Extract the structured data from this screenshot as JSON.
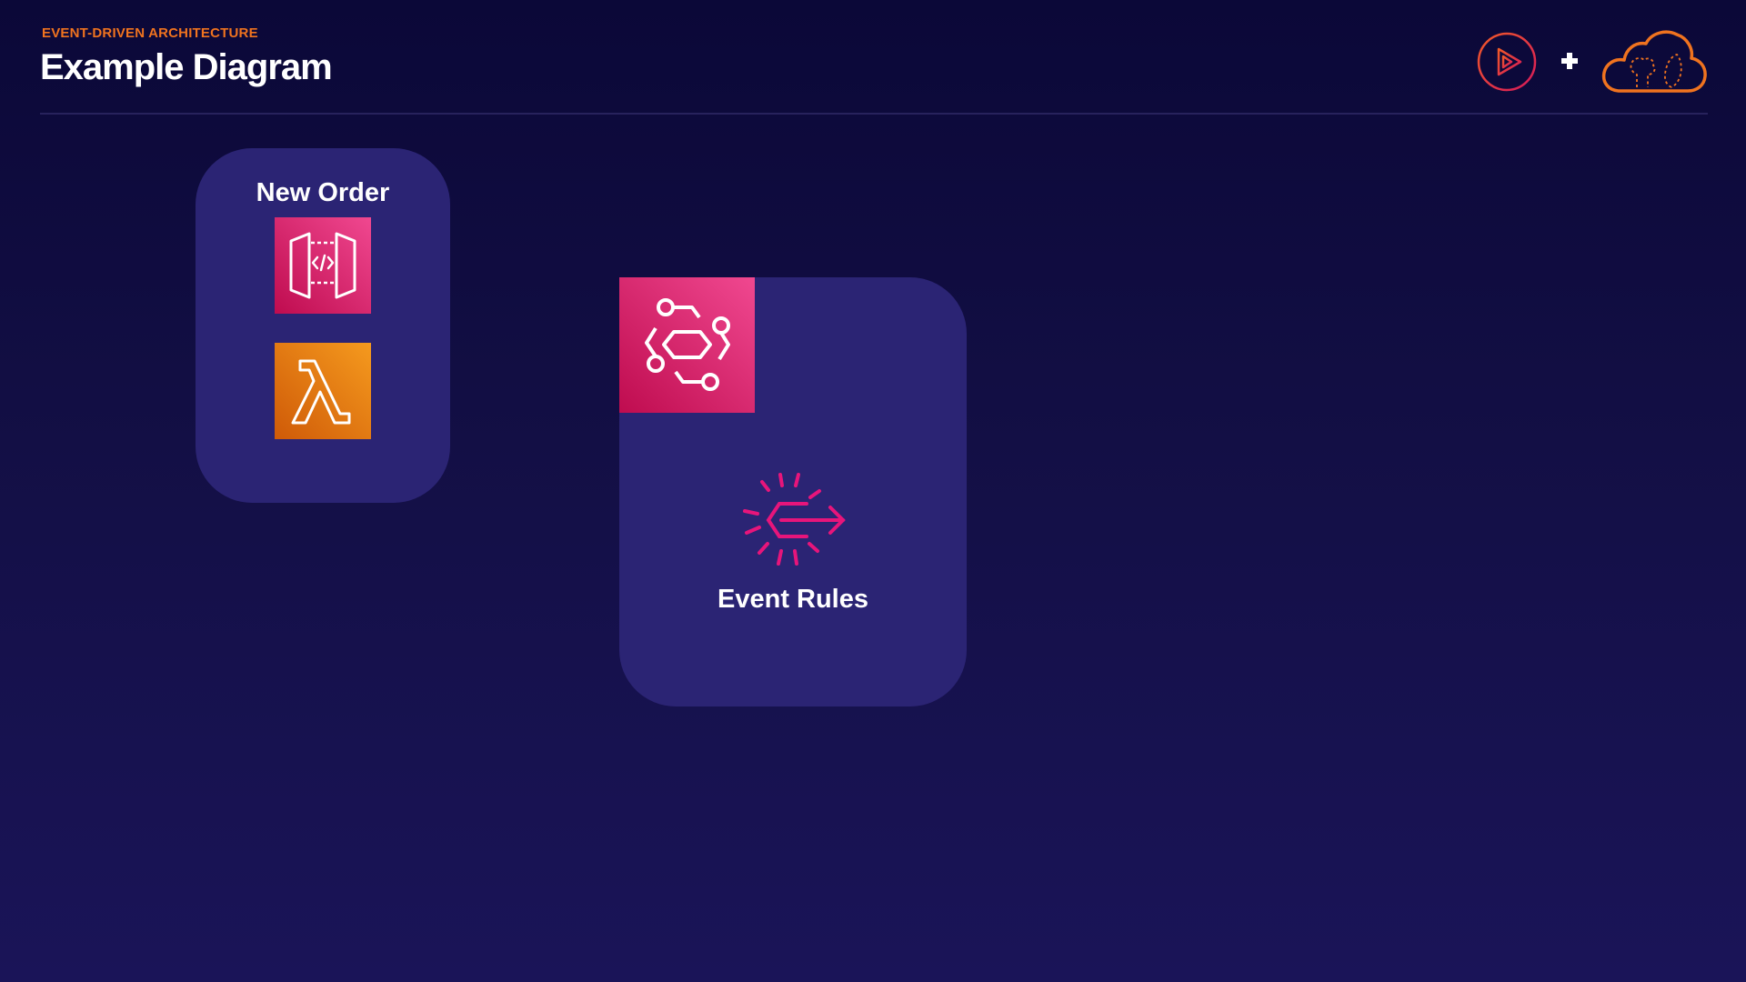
{
  "header": {
    "eyebrow": "EVENT-DRIVEN ARCHITECTURE",
    "title": "Example Diagram"
  },
  "brand": {
    "play_icon": "play-circle-icon",
    "plus_icon": "plus-icon",
    "cloud_icon": "cloud-brain-icon",
    "play_color": "#e0244f",
    "cloud_color": "#f0731f"
  },
  "diagram": {
    "groups": [
      {
        "label": "New Order",
        "services": [
          {
            "name": "Amazon API Gateway",
            "icon": "api-gateway-icon",
            "color": "#e7157b"
          },
          {
            "name": "AWS Lambda",
            "icon": "lambda-icon",
            "color": "#ed7100"
          }
        ]
      },
      {
        "label": "Event Rules",
        "services": [
          {
            "name": "Amazon EventBridge",
            "icon": "eventbridge-icon",
            "color": "#e7157b"
          },
          {
            "name": "EventBridge Rule",
            "icon": "event-rule-icon",
            "color": "#e7157b"
          }
        ]
      }
    ]
  },
  "colors": {
    "background": "#130f45",
    "group_fill": "#2b2474",
    "eyebrow": "#f0731f",
    "title": "#ffffff"
  }
}
